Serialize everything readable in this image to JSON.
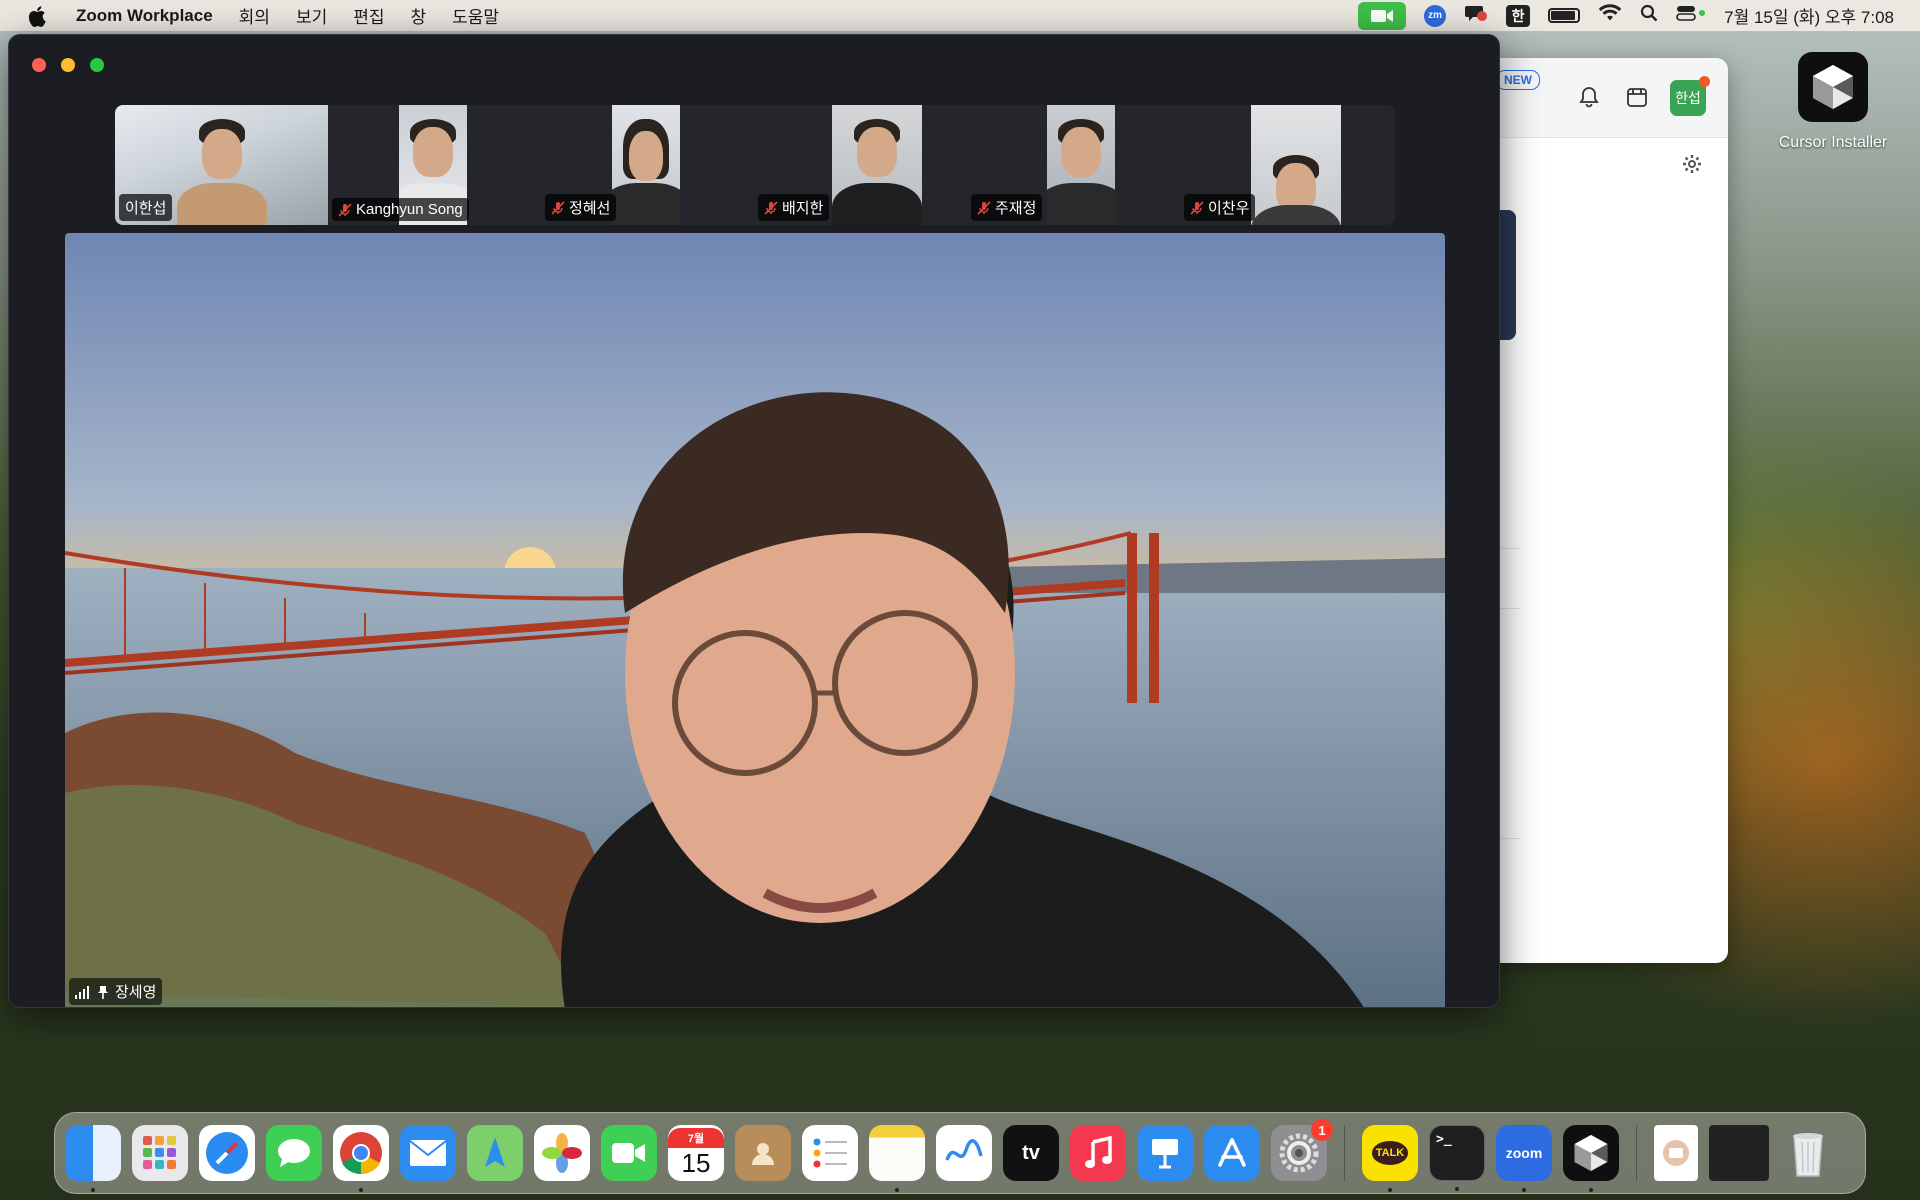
{
  "menubar": {
    "app_name": "Zoom Workplace",
    "menus": [
      "회의",
      "보기",
      "편집",
      "창",
      "도움말"
    ],
    "input_source": "한",
    "clock": "7월 15일 (화) 오후 7:08"
  },
  "desktop": {
    "cursor_installer_label": "Cursor Installer"
  },
  "side_panel": {
    "new_badge": "NEW",
    "avatar_text": "한섭"
  },
  "meeting": {
    "participants": [
      {
        "name": "이한섭",
        "muted": false
      },
      {
        "name": "Kanghyun Song",
        "muted": true
      },
      {
        "name": "정혜선",
        "muted": true
      },
      {
        "name": "배지한",
        "muted": true
      },
      {
        "name": "주재정",
        "muted": true
      },
      {
        "name": "이찬우",
        "muted": true
      }
    ],
    "active_speaker": "장세영"
  },
  "dock": {
    "calendar_month": "7월",
    "calendar_day": "15",
    "settings_badge": "1",
    "kakao_label": "TALK",
    "zoom_label": "zoom",
    "tv_label": "tv",
    "terminal_label": ">_"
  },
  "colors": {
    "zoom_green": "#3fbf4a",
    "zoom_blue": "#2d6ce0",
    "mute_red": "#e0453a",
    "window_bg": "#1b1d22"
  }
}
